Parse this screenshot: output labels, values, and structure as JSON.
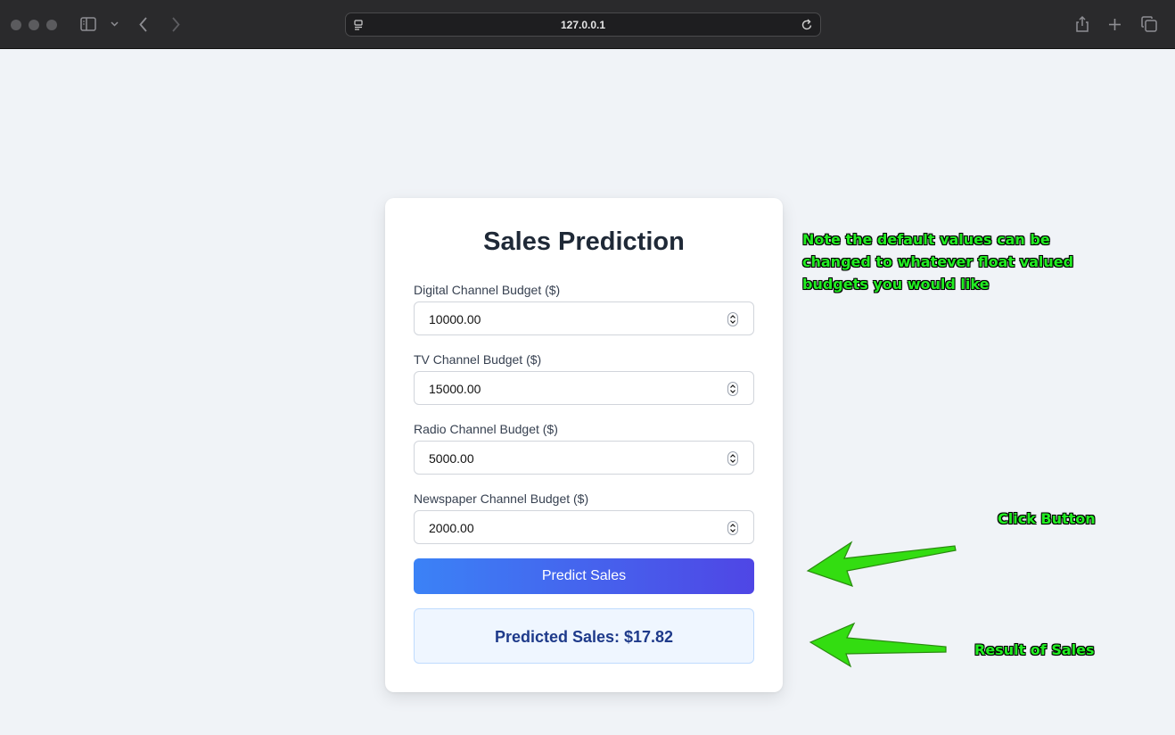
{
  "browser": {
    "url": "127.0.0.1",
    "icons": [
      "sidebar-icon",
      "chevron-down-icon",
      "back-icon",
      "forward-icon",
      "site-icon",
      "reload-icon",
      "share-icon",
      "new-tab-icon",
      "tabs-overview-icon"
    ]
  },
  "form": {
    "title": "Sales Prediction",
    "fields": [
      {
        "label": "Digital Channel Budget ($)",
        "value": "10000.00"
      },
      {
        "label": "TV Channel Budget ($)",
        "value": "15000.00"
      },
      {
        "label": "Radio Channel Budget ($)",
        "value": "5000.00"
      },
      {
        "label": "Newspaper Channel Budget ($)",
        "value": "2000.00"
      }
    ],
    "button_label": "Predict Sales",
    "result_text": "Predicted Sales: $17.82"
  },
  "annotations": {
    "note_lines": [
      "Note the default values can be",
      "changed to whatever float valued",
      "budgets you would like"
    ],
    "click_button": "Click Button",
    "result_of_sales": "Result of Sales"
  },
  "colors": {
    "accent_start": "#3b82f6",
    "accent_end": "#4f46e5",
    "annotation_green": "#22ee22",
    "arrow_green": "#33dd11",
    "result_text": "#1e3a8a"
  }
}
